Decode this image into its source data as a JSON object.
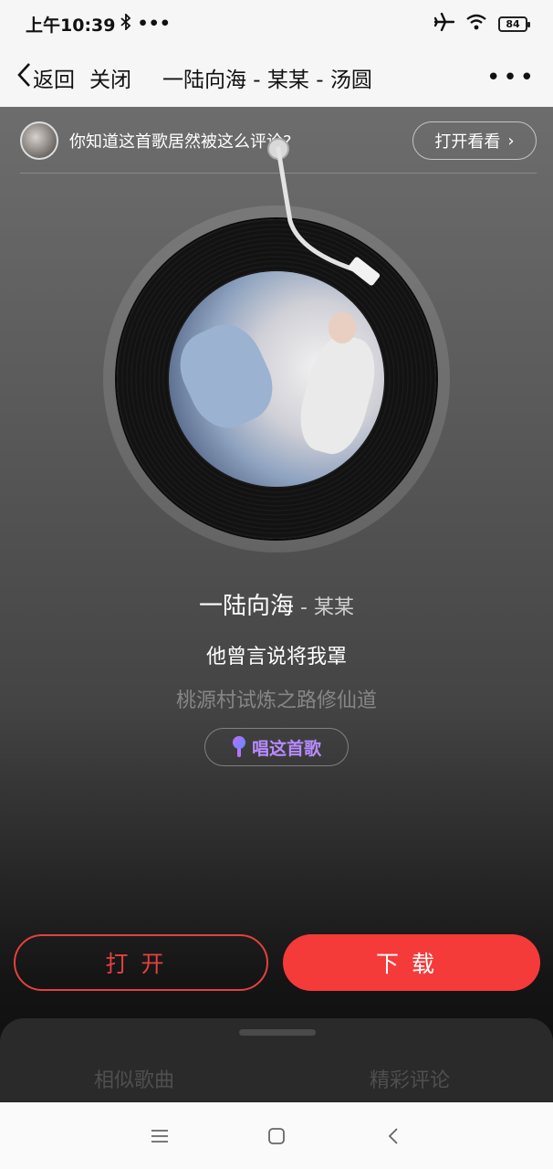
{
  "status_bar": {
    "time": "上午10:39",
    "bluetooth_icon": "bluetooth-icon",
    "dots": "•••",
    "battery": "84",
    "icons": [
      "airplane-icon",
      "wifi-icon",
      "battery-icon"
    ]
  },
  "nav": {
    "back_label": "返回",
    "close_label": "关闭",
    "title": "一陆向海 - 某某 - 汤圆",
    "more": "•••"
  },
  "banner": {
    "text": "你知道这首歌居然被这么评论?",
    "button_label": "打开看看",
    "chevron": "›"
  },
  "song": {
    "name": "一陆向海",
    "separator": " - ",
    "artist": "某某",
    "lyric_current": "他曾言说将我罩",
    "lyric_next": "桃源村试炼之路修仙道"
  },
  "sing_button": {
    "label": "唱这首歌"
  },
  "actions": {
    "open_label": "打开",
    "download_label": "下载"
  },
  "sheet": {
    "tab_similar": "相似歌曲",
    "tab_comments": "精彩评论"
  },
  "colors": {
    "accent_red": "#f53a3a",
    "sing_purple": "#b88bff"
  }
}
